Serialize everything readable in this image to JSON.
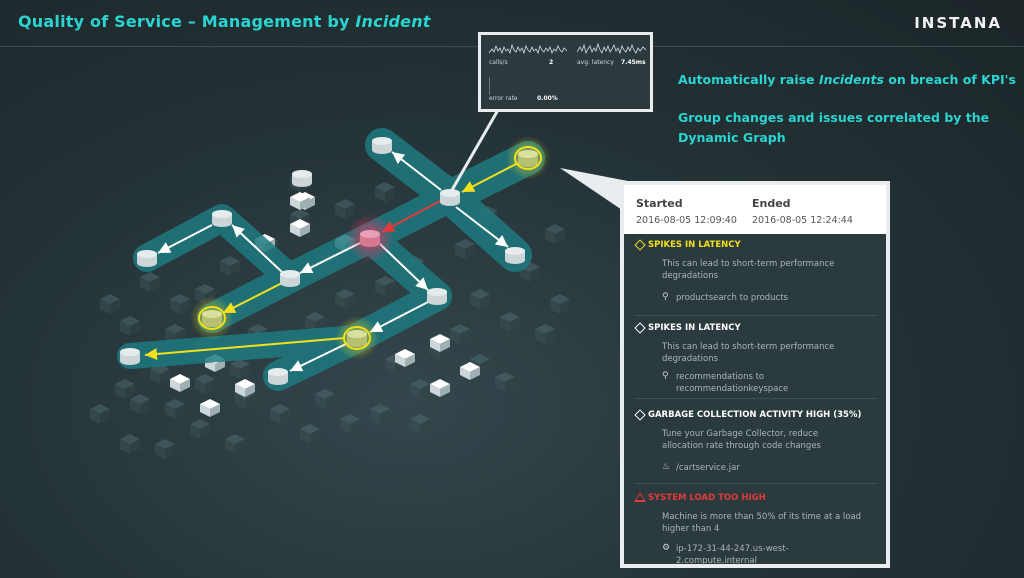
{
  "header": {
    "title_prefix": "Quality of Service – Management by ",
    "title_emphasis": "Incident",
    "brand": "INSTANA"
  },
  "callouts": {
    "line1_prefix": "Automatically raise ",
    "line1_emphasis": "Incidents",
    "line1_suffix": " on breach of KPI's",
    "line2": "Group changes and issues correlated by the",
    "line3": "Dynamic Graph"
  },
  "metrics_popup": {
    "calls_label": "calls/s",
    "calls_value": "2",
    "latency_label": "avg. latency",
    "latency_value": "7.45ms",
    "error_label": "error rate",
    "error_value": "0.00%"
  },
  "incident_panel": {
    "started_label": "Started",
    "started_value": "2016-08-05 12:09:40",
    "ended_label": "Ended",
    "ended_value": "2016-08-05 12:24:44",
    "events": [
      {
        "title": "SPIKES IN LATENCY",
        "severity": "warning",
        "color": "#f2e01c",
        "description": "This can lead to short-term performance degradations",
        "entity": "productsearch to products",
        "entity_icon": "service-link-icon"
      },
      {
        "title": "SPIKES IN LATENCY",
        "severity": "change",
        "color": "#ffffff",
        "description": "This can lead to short-term performance degradations",
        "entity": "recommendations to recommendationkeyspace",
        "entity_icon": "service-link-icon"
      },
      {
        "title": "GARBAGE COLLECTION ACTIVITY HIGH (35%)",
        "severity": "change",
        "color": "#ffffff",
        "description": "Tune your Garbage Collector, reduce allocation rate through code changes",
        "entity": "/cartservice.jar",
        "entity_icon": "java-icon"
      },
      {
        "title": "SYSTEM LOAD TOO HIGH",
        "severity": "critical",
        "color": "#e03a3a",
        "description": "Machine is more than 50% of its time at a load higher than 4",
        "entity": "ip-172-31-44-247.us-west-2.compute.internal",
        "entity_icon": "host-icon"
      }
    ]
  },
  "colors": {
    "accent": "#2ad4d0",
    "warning": "#f2e01c",
    "critical": "#e03a3a",
    "panel_bg": "#2b3a3d"
  }
}
